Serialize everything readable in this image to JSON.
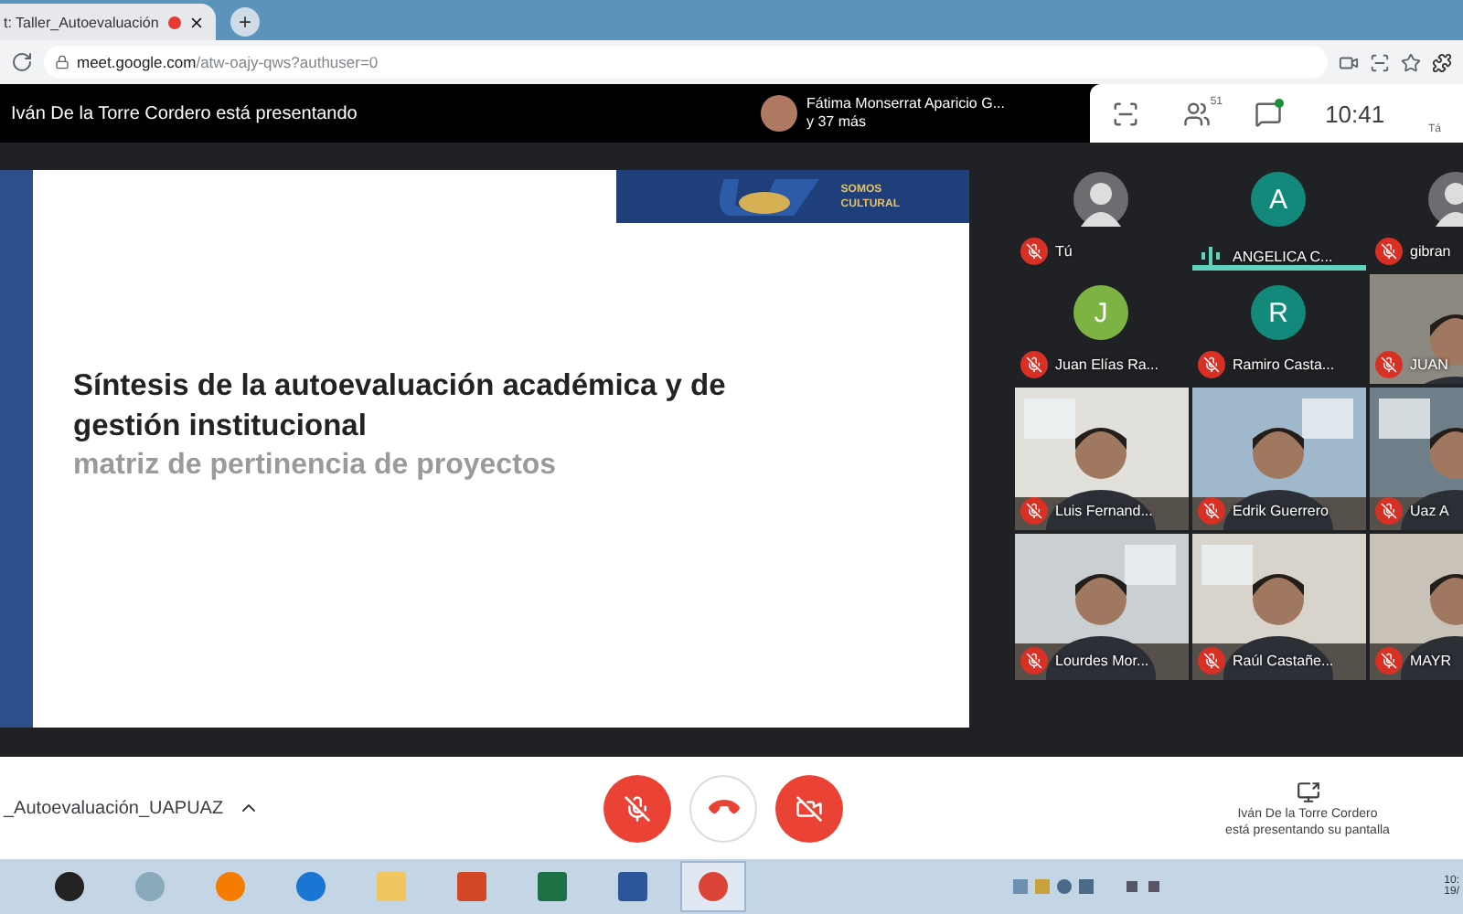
{
  "browser": {
    "tab": {
      "title": "t: Taller_Autoevaluación",
      "recording": true
    },
    "new_tab": "+",
    "url": {
      "host": "meet.google.com",
      "path": "/atw-oajy-qws?authuser=0"
    }
  },
  "meet_header": {
    "presenter_notice": "Iván De la Torre Cordero está presentando",
    "preview": {
      "name": "Fátima Monserrat Aparicio G...",
      "more": "y 37 más"
    },
    "people_count": "51",
    "chat_unread": true,
    "time": "10:41",
    "cut_label": "Tá"
  },
  "slide": {
    "banner": [
      "SOMOS",
      "CULTURAL"
    ],
    "title": "Síntesis de la autoevaluación académica y de gestión institucional",
    "subtitle": "matriz de pertinencia de proyectos"
  },
  "participants": [
    {
      "name": "Tú",
      "kind": "avatar",
      "muted": true
    },
    {
      "name": "ANGELICA C...",
      "kind": "initial",
      "initial": "A",
      "color": "#12897a",
      "muted": false
    },
    {
      "name": "gibran",
      "kind": "avatar",
      "muted": true
    },
    {
      "name": "Juan Elías Ra...",
      "kind": "initial",
      "initial": "J",
      "color": "#7cb342",
      "muted": true
    },
    {
      "name": "Ramiro Casta...",
      "kind": "initial",
      "initial": "R",
      "color": "#12897a",
      "muted": true
    },
    {
      "name": "JUAN",
      "muted": true
    },
    {
      "name": "Luis Fernand...",
      "muted": true
    },
    {
      "name": "Edrik Guerrero",
      "muted": true
    },
    {
      "name": "Uaz A",
      "muted": true
    },
    {
      "name": "Lourdes Mor...",
      "muted": true
    },
    {
      "name": "Raúl Castañe...",
      "muted": true
    },
    {
      "name": "MAYR",
      "muted": true
    }
  ],
  "footer": {
    "meeting_name": "_Autoevaluación_UAPUAZ",
    "controls": [
      {
        "kind": "mic",
        "off": true
      },
      {
        "kind": "hangup",
        "off": false
      },
      {
        "kind": "camera",
        "off": true
      }
    ],
    "presenting": [
      "Iván De la Torre Cordero",
      "está presentando su pantalla"
    ]
  },
  "taskbar": {
    "apps": [
      {
        "kind": "download",
        "selected": false
      },
      {
        "kind": "paint",
        "selected": false
      },
      {
        "kind": "firefox",
        "selected": false
      },
      {
        "kind": "edge",
        "selected": false
      },
      {
        "kind": "explorer",
        "selected": false
      },
      {
        "kind": "powerpoint",
        "selected": false
      },
      {
        "kind": "excel",
        "selected": false
      },
      {
        "kind": "word",
        "selected": false
      },
      {
        "kind": "chrome",
        "selected": true
      }
    ],
    "clock": [
      "10:",
      "19/"
    ]
  }
}
